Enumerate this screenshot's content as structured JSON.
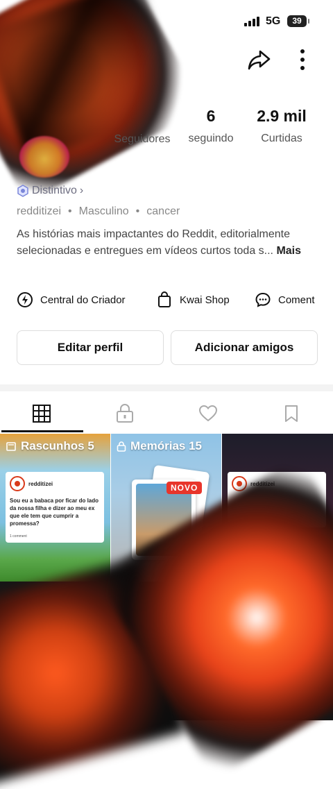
{
  "status_bar": {
    "network": "5G",
    "battery": "39"
  },
  "stats": [
    {
      "value": "",
      "label": "Seguidores"
    },
    {
      "value": "6",
      "label": "seguindo"
    },
    {
      "value": "2.9 mil",
      "label": "Curtidas"
    }
  ],
  "badge": {
    "label": "Distintivo"
  },
  "meta": {
    "username": "redditizei",
    "gender": "Masculino",
    "tag": "cancer",
    "separator": "•"
  },
  "bio": {
    "text": "As histórias mais impactantes do Reddit, editorialmente selecionadas e entregues em vídeos curtos toda s...",
    "more": "Mais"
  },
  "tools": [
    {
      "label": "Central do Criador",
      "icon": "lightning-icon"
    },
    {
      "label": "Kwai Shop",
      "icon": "shopping-bag-icon"
    },
    {
      "label": "Coment",
      "icon": "comment-icon"
    }
  ],
  "buttons": {
    "edit": "Editar perfil",
    "add": "Adicionar amigos"
  },
  "tabs": [
    "grid-icon",
    "lock-icon",
    "heart-icon",
    "bookmark-icon"
  ],
  "grid": {
    "drafts": {
      "label": "Rascunhos 5"
    },
    "memories": {
      "label": "Memórias 15",
      "badge": "NOVO"
    },
    "post_user": "redditizei",
    "post_title": "Sou eu a babaca por ficar do lado da nossa filha e dizer ao meu ex que ele tem que cumprir a promessa?",
    "post_foot": "1 comment"
  },
  "colors": {
    "accent_red": "#e8352b",
    "brand_orange": "#ff5a1f"
  }
}
